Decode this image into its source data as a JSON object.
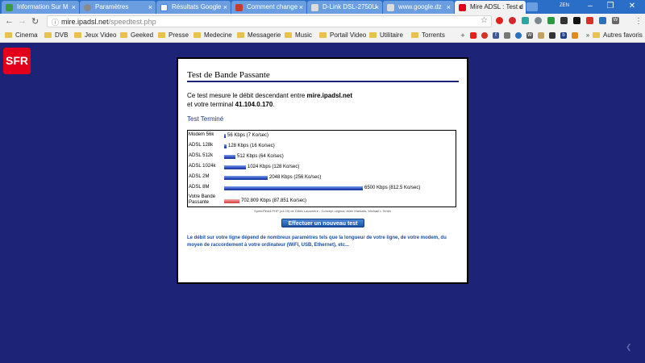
{
  "browser": {
    "tabs": [
      {
        "title": "Information Sur M",
        "favicon_color": "#3c9c3c",
        "active": false
      },
      {
        "title": "Paramètres",
        "favicon_color": "#8a8a8a",
        "active": false
      },
      {
        "title": "Résultats Google",
        "favicon_color": "#ffffff",
        "active": false
      },
      {
        "title": "Comment change",
        "favicon_color": "#c73a2e",
        "active": false
      },
      {
        "title": "D-Link DSL-2750U",
        "favicon_color": "#dcdcdc",
        "active": false
      },
      {
        "title": "www.google.dz",
        "favicon_color": "#dcdcdc",
        "active": false
      },
      {
        "title": "Mire ADSL : Test d",
        "favicon_color": "#e2001a",
        "active": true
      }
    ],
    "user_chip": "ZEN",
    "url_host": "mire.ipadsl.net",
    "url_path": "/speedtest.php",
    "bookmarks": [
      "Cinema",
      "DVB",
      "Jeux Video",
      "Geeked",
      "Presse",
      "Medecine",
      "Messagerie",
      "Music",
      "Portail Video",
      "Utilitaire",
      "Torrents"
    ],
    "other_bookmarks": "Autres favoris"
  },
  "page": {
    "logo": "SFR",
    "title": "Test de Bande Passante",
    "intro": "Ce test mesure le débit descendant entre ",
    "host": "mire.ipadsl.net",
    "intro2": "et votre terminal ",
    "ip": "41.104.0.170",
    "status": "Test Terminé",
    "results": [
      {
        "label": "Modem 56k",
        "kbps": 56,
        "text": "56 Kbps (7 Ko/sec)"
      },
      {
        "label": "ADSL 128k",
        "kbps": 128,
        "text": "128 Kbps (16 Ko/sec)"
      },
      {
        "label": "ADSL 512k",
        "kbps": 512,
        "text": "512 Kbps (64 Ko/sec)"
      },
      {
        "label": "ADSL 1024k",
        "kbps": 1024,
        "text": "1024 Kbps (128 Ko/sec)"
      },
      {
        "label": "ADSL 2M",
        "kbps": 2048,
        "text": "2048 Kbps (256 Ko/sec)"
      },
      {
        "label": "ADSL 8M",
        "kbps": 6500,
        "text": "6500 Kbps (812.5 Ko/sec)"
      },
      {
        "label": "Votre Bande Passante",
        "kbps": 702.809,
        "text": "702.809 Kbps (87.851 Ko/sec)",
        "user": true
      }
    ],
    "credits": "SpeedTest4.PHP (v4.29) de Gilles Lacarrière - Concept original: Allen Marsalis, Michael L Smith",
    "button": "Effectuer un nouveau test",
    "note": "Le débit sur votre ligne dépend de nombreux paramètres tels que la longueur de votre ligne, de votre modem, du moyen de raccordement à votre ordinateur (WiFi, USB, Ethernet), etc..."
  }
}
